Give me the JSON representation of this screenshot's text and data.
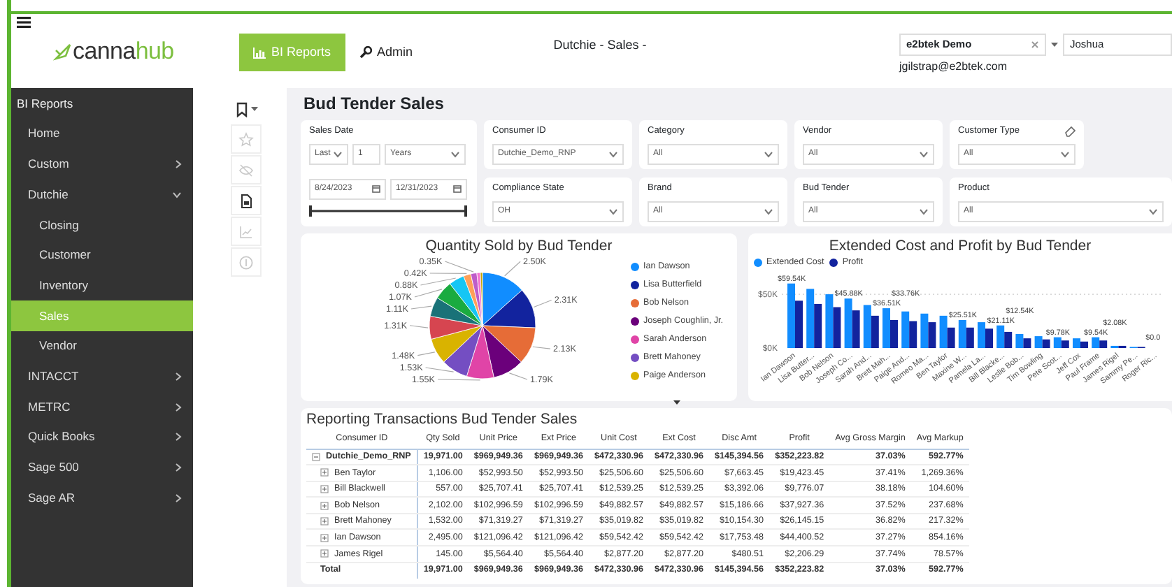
{
  "header": {
    "logo": [
      "canna",
      "hub"
    ],
    "nav": [
      {
        "label": "BI Reports",
        "selected": true
      },
      {
        "label": "Admin",
        "selected": false
      }
    ],
    "page_title": "Dutchie - Sales -",
    "company_select": {
      "value": "e2btek Demo"
    },
    "user_select": {
      "value": "Joshua"
    },
    "email": "jgilstrap@e2btek.com"
  },
  "sidebar": {
    "heading": "BI Reports",
    "items": [
      {
        "label": "Home",
        "kind": "link",
        "selected": false
      },
      {
        "label": "Custom",
        "kind": "group",
        "expanded": false,
        "selected": false
      },
      {
        "label": "Dutchie",
        "kind": "group",
        "expanded": true,
        "selected": false,
        "children": [
          {
            "label": "Closing",
            "kind": "link",
            "selected": false
          },
          {
            "label": "Customer",
            "kind": "link",
            "selected": false
          },
          {
            "label": "Inventory",
            "kind": "link",
            "selected": false
          },
          {
            "label": "Sales",
            "kind": "link",
            "selected": true
          },
          {
            "label": "Vendor",
            "kind": "link",
            "selected": false
          }
        ]
      },
      {
        "label": "INTACCT",
        "kind": "group",
        "expanded": false,
        "selected": false
      },
      {
        "label": "METRC",
        "kind": "group",
        "expanded": false,
        "selected": false
      },
      {
        "label": "Quick Books",
        "kind": "group",
        "expanded": false,
        "selected": false
      },
      {
        "label": "Sage 500",
        "kind": "group",
        "expanded": false,
        "selected": false
      },
      {
        "label": "Sage AR",
        "kind": "group",
        "expanded": false,
        "selected": false
      }
    ]
  },
  "tools": [
    {
      "kind": "bookmark",
      "disabled": false
    },
    {
      "kind": "star",
      "disabled": true
    },
    {
      "kind": "eye-slash",
      "disabled": true
    },
    {
      "kind": "page",
      "disabled": false
    },
    {
      "kind": "chart",
      "disabled": true
    },
    {
      "kind": "info",
      "disabled": true
    }
  ],
  "report": {
    "title": "Bud Tender Sales",
    "filters": [
      {
        "kind": "date-range",
        "label": "Sales Date",
        "mode": "Last",
        "count": "1",
        "unit": "Years",
        "start": "8/24/2023",
        "end": "12/31/2023",
        "handles": [
          {
            "level": 0
          },
          {
            "level": 1
          }
        ]
      },
      {
        "kind": "dropdown",
        "label": "Consumer ID",
        "value": "Dutchie_Demo_RNP"
      },
      {
        "kind": "dropdown",
        "label": "Category",
        "value": "All"
      },
      {
        "kind": "dropdown",
        "label": "Vendor",
        "value": "All"
      },
      {
        "kind": "dropdown",
        "label": "Customer Type",
        "value": "All",
        "eraser": true
      },
      {
        "kind": "dropdown",
        "label": "Compliance State",
        "value": "OH"
      },
      {
        "kind": "dropdown",
        "label": "Brand",
        "value": "All"
      },
      {
        "kind": "dropdown",
        "label": "Bud Tender",
        "value": "All"
      },
      {
        "kind": "dropdown",
        "label": "Product",
        "value": "All"
      }
    ],
    "pie": {
      "chart_data": {
        "type": "pie",
        "title": "Quantity Sold by Bud Tender",
        "values": [
          2.5,
          2.31,
          2.13,
          1.79,
          1.55,
          1.53,
          1.48,
          1.31,
          1.11,
          1.07,
          0.88,
          0.42,
          0.35,
          0.2,
          0.12
        ],
        "value_labels": [
          "2.50K",
          "2.31K",
          "2.13K",
          "1.79K",
          "1.55K",
          "1.53K",
          "1.48K",
          "1.31K",
          "1.11K",
          "1.07K",
          "0.88K",
          "0.42K",
          "0.35K",
          null,
          null
        ],
        "colors": [
          "#118dff",
          "#12239e",
          "#e66c37",
          "#6b007b",
          "#e044a7",
          "#744ec2",
          "#d9b300",
          "#d64550",
          "#197278",
          "#1aab40",
          "#15c6f4",
          "#ffa058",
          "#be5dc9",
          "#f472d0",
          "#c5a800"
        ]
      },
      "legend": [
        {
          "name": "Ian Dawson",
          "color": "#118dff"
        },
        {
          "name": "Lisa Butterfield",
          "color": "#12239e"
        },
        {
          "name": "Bob Nelson",
          "color": "#e66c37"
        },
        {
          "name": "Joseph Coughlin, Jr.",
          "color": "#6b007b"
        },
        {
          "name": "Sarah Anderson",
          "color": "#e044a7"
        },
        {
          "name": "Brett Mahoney",
          "color": "#744ec2"
        },
        {
          "name": "Paige Anderson",
          "color": "#d9b300"
        }
      ]
    },
    "bars": {
      "chart_data": {
        "type": "bar",
        "title": "Extended Cost and Profit by Bud Tender",
        "categories": [
          "Ian Dawson",
          "Lisa Butter...",
          "Bob Nelson",
          "Joseph Co...",
          "Sarah And...",
          "Brett Mah...",
          "Paige And...",
          "Romeo Ma...",
          "Ben Taylor",
          "Maxine W...",
          "Pamela La...",
          "Bill Blacke...",
          "Leslie Bob...",
          "Tim Bowling",
          "Pete Scot...",
          "Jeff Cox",
          "Paul Frame",
          "James Rigel",
          "Sammy Pe...",
          "Roger Ric..."
        ],
        "series": [
          {
            "name": "Extended Cost",
            "color": "#118dff",
            "values": [
              60,
              55,
              50,
              46,
              40,
              37,
              34,
              32,
              30,
              26,
              24,
              21,
              13,
              11,
              10,
              9,
              10,
              2,
              1,
              0
            ]
          },
          {
            "name": "Profit",
            "color": "#12239e",
            "values": [
              44,
              41,
              38,
              35,
              30,
              26,
              25,
              24,
              19,
              19,
              18,
              15,
              9,
              8,
              7,
              6,
              7,
              2,
              1,
              0
            ]
          }
        ],
        "value_labels": [
          "$59.54K",
          null,
          null,
          "$45.88K",
          null,
          "$36.51K",
          "$33.76K",
          null,
          null,
          "$25.51K",
          null,
          "$21.11K",
          "$12.54K",
          null,
          "$9.78K",
          null,
          "$9.54K",
          "$2.08K",
          null,
          "$0.0"
        ],
        "ylim": [
          0,
          65
        ],
        "yticks": [
          {
            "value": 0,
            "label": "$0K"
          },
          {
            "value": 50,
            "label": "$50K"
          }
        ]
      }
    },
    "table": {
      "title": "Reporting Transactions Bud Tender Sales",
      "columns": [
        "Consumer ID",
        "Qty Sold",
        "Unit Price",
        "Ext Price",
        "Unit Cost",
        "Ext Cost",
        "Disc Amt",
        "Profit",
        "Avg Gross Margin",
        "Avg Markup"
      ],
      "rows": [
        {
          "kind": "group",
          "expanded": true,
          "cells": [
            "Dutchie_Demo_RNP",
            "19,971.00",
            "$969,949.36",
            "$969,949.36",
            "$472,330.96",
            "$472,330.96",
            "$145,394.56",
            "$352,223.82",
            "37.03%",
            "592.77%"
          ]
        },
        {
          "kind": "member",
          "expanded": false,
          "cells": [
            "Ben Taylor",
            "1,106.00",
            "$52,993.50",
            "$52,993.50",
            "$25,506.60",
            "$25,506.60",
            "$7,663.45",
            "$19,423.45",
            "37.41%",
            "1,269.36%"
          ]
        },
        {
          "kind": "member",
          "expanded": false,
          "cells": [
            "Bill Blackwell",
            "557.00",
            "$25,707.41",
            "$25,707.41",
            "$12,539.25",
            "$12,539.25",
            "$3,392.06",
            "$9,776.07",
            "38.18%",
            "104.60%"
          ]
        },
        {
          "kind": "member",
          "expanded": false,
          "cells": [
            "Bob Nelson",
            "2,102.00",
            "$102,996.59",
            "$102,996.59",
            "$49,882.57",
            "$49,882.57",
            "$15,186.66",
            "$37,927.36",
            "37.52%",
            "237.68%"
          ]
        },
        {
          "kind": "member",
          "expanded": false,
          "cells": [
            "Brett Mahoney",
            "1,532.00",
            "$71,319.27",
            "$71,319.27",
            "$35,019.82",
            "$35,019.82",
            "$10,154.30",
            "$26,145.15",
            "36.82%",
            "217.32%"
          ]
        },
        {
          "kind": "member",
          "expanded": false,
          "cells": [
            "Ian Dawson",
            "2,495.00",
            "$121,096.42",
            "$121,096.42",
            "$59,542.42",
            "$59,542.42",
            "$17,753.48",
            "$44,400.52",
            "37.27%",
            "854.16%"
          ]
        },
        {
          "kind": "member",
          "expanded": false,
          "cells": [
            "James Rigel",
            "145.00",
            "$5,564.40",
            "$5,564.40",
            "$2,877.20",
            "$2,877.20",
            "$480.51",
            "$2,206.29",
            "37.74%",
            "78.57%"
          ]
        },
        {
          "kind": "total",
          "cells": [
            "Total",
            "19,971.00",
            "$969,949.36",
            "$969,949.36",
            "$472,330.96",
            "$472,330.96",
            "$145,394.56",
            "$352,223.82",
            "37.03%",
            "592.77%"
          ]
        }
      ]
    }
  }
}
